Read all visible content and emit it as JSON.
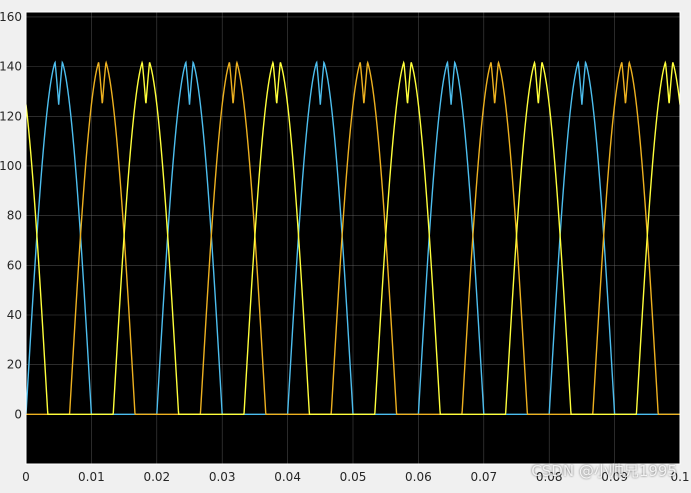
{
  "chart_data": {
    "type": "line",
    "title": "",
    "xlabel": "",
    "ylabel": "",
    "xlim": [
      0,
      0.1
    ],
    "ylim": [
      -20,
      162
    ],
    "x_ticks": [
      0,
      0.01,
      0.02,
      0.03,
      0.04,
      0.05,
      0.06,
      0.07,
      0.08,
      0.09,
      0.1
    ],
    "x_tick_labels": [
      "0",
      "0.01",
      "0.02",
      "0.03",
      "0.04",
      "0.05",
      "0.06",
      "0.07",
      "0.08",
      "0.09",
      "0.1"
    ],
    "y_ticks": [
      0,
      20,
      40,
      60,
      80,
      100,
      120,
      140,
      160
    ],
    "y_tick_labels": [
      "0",
      "20",
      "40",
      "60",
      "80",
      "100",
      "120",
      "140",
      "160"
    ],
    "grid": true,
    "background": "#000000",
    "frame_color": "#ffffff",
    "grid_color": "#7f7f7f",
    "waveform": {
      "amplitude": 144,
      "period": 0.02,
      "ripple_floor": 124.7,
      "min_value": 0,
      "samples": 2001
    },
    "series": [
      {
        "color": "#4DBEEE",
        "phase_deg": 0
      },
      {
        "color": "#EDB120",
        "phase_deg": -120
      },
      {
        "color": "#FFFF3B",
        "phase_deg": 120
      }
    ]
  },
  "watermark": "CSDN @小帅兄1995"
}
